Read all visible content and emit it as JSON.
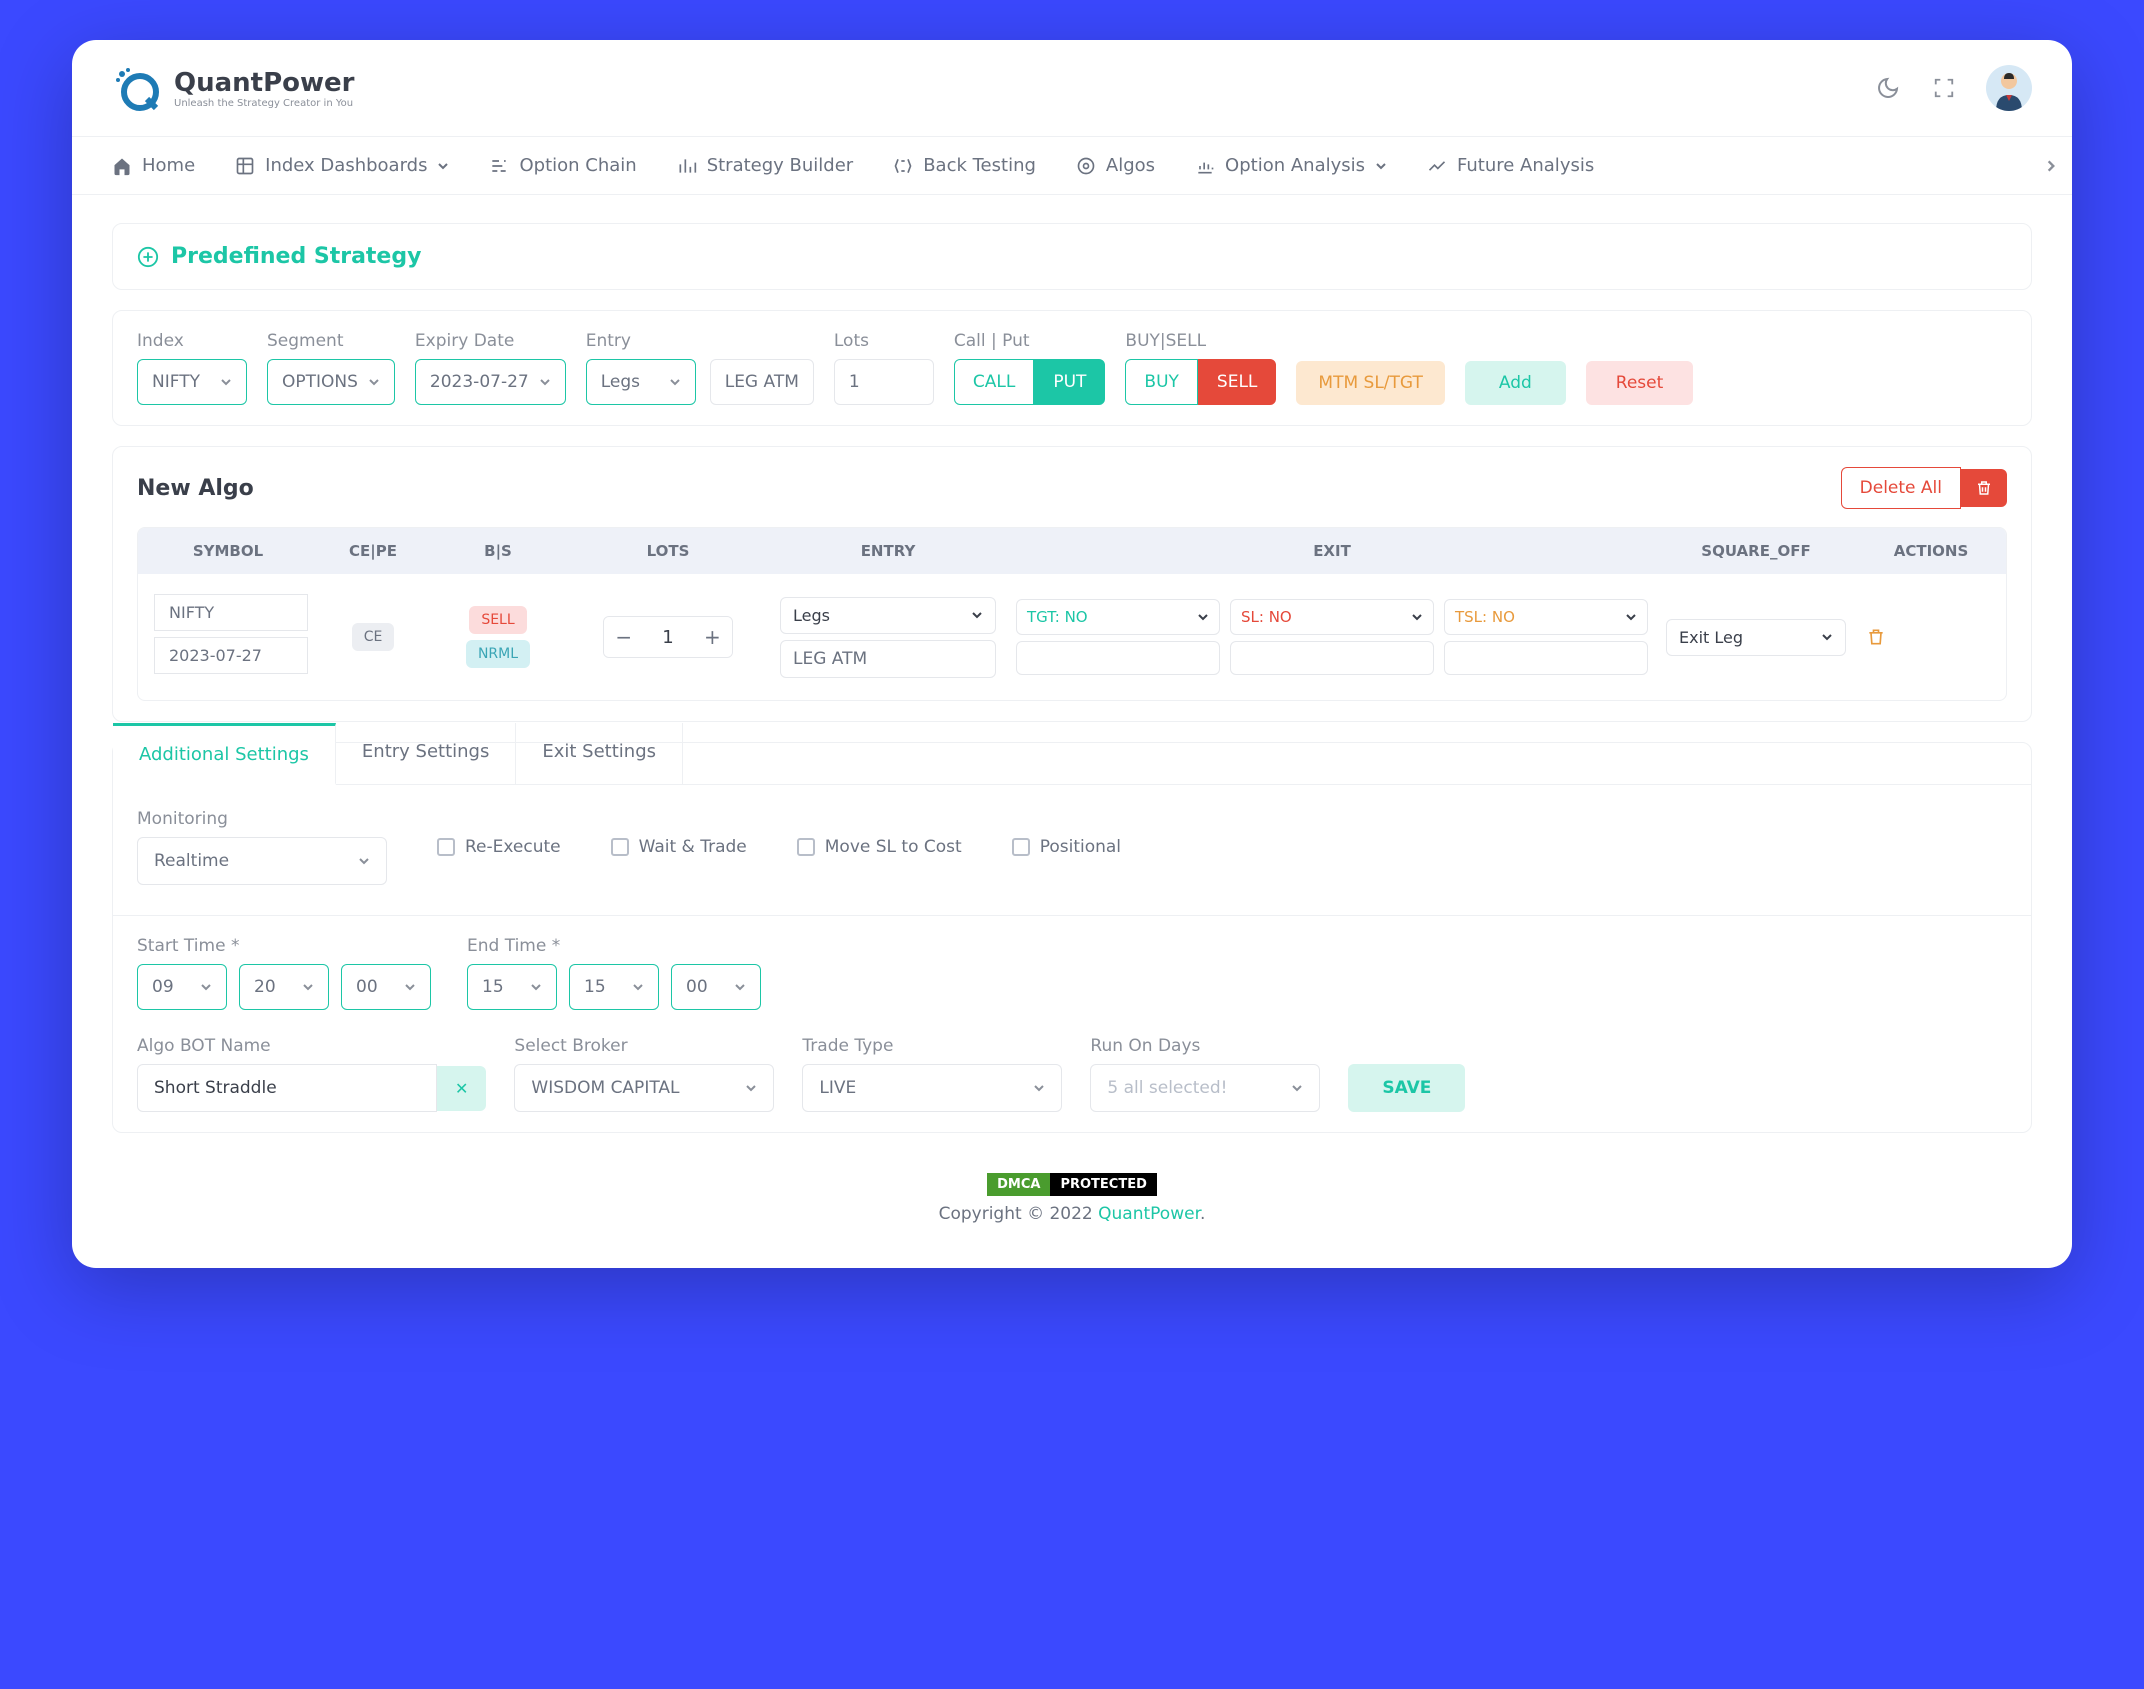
{
  "brand": {
    "name": "QuantPower",
    "tagline": "Unleash the Strategy Creator in You"
  },
  "nav": {
    "items": [
      "Home",
      "Index Dashboards",
      "Option Chain",
      "Strategy Builder",
      "Back Testing",
      "Algos",
      "Option Analysis",
      "Future Analysis"
    ]
  },
  "predefined": {
    "label": "Predefined Strategy"
  },
  "filters": {
    "index_lbl": "Index",
    "index_val": "NIFTY",
    "segment_lbl": "Segment",
    "segment_val": "OPTIONS",
    "expiry_lbl": "Expiry Date",
    "expiry_val": "2023-07-27",
    "entry_lbl": "Entry",
    "entry_val": "Legs",
    "entry_atm": "LEG ATM",
    "lots_lbl": "Lots",
    "lots_val": "1",
    "callput_lbl": "Call | Put",
    "call": "CALL",
    "put": "PUT",
    "buysell_lbl": "BUY|SELL",
    "buy": "BUY",
    "sell": "SELL",
    "mtm": "MTM SL/TGT",
    "add": "Add",
    "reset": "Reset"
  },
  "algo": {
    "title": "New Algo",
    "delete_all": "Delete All",
    "cols": {
      "symbol": "SYMBOL",
      "cepe": "CE|PE",
      "bs": "B|S",
      "lots": "LOTS",
      "entry": "ENTRY",
      "exit": "EXIT",
      "sqoff": "SQUARE_OFF",
      "actions": "ACTIONS"
    },
    "row": {
      "symbol": "NIFTY",
      "date": "2023-07-27",
      "cepe": "CE",
      "sell": "SELL",
      "nrml": "NRML",
      "lots": "1",
      "entry_type": "Legs",
      "entry_atm": "LEG ATM",
      "tgt": "TGT: NO",
      "sl": "SL: NO",
      "tsl": "TSL: NO",
      "sqoff": "Exit Leg"
    }
  },
  "tabs": {
    "additional": "Additional Settings",
    "entry": "Entry Settings",
    "exit": "Exit Settings"
  },
  "settings": {
    "monitoring_lbl": "Monitoring",
    "monitoring_val": "Realtime",
    "reexec": "Re-Execute",
    "wait": "Wait & Trade",
    "movesl": "Move SL to Cost",
    "positional": "Positional",
    "start_lbl": "Start Time *",
    "start_h": "09",
    "start_m": "20",
    "start_s": "00",
    "end_lbl": "End Time *",
    "end_h": "15",
    "end_m": "15",
    "end_s": "00",
    "bot_lbl": "Algo BOT Name",
    "bot_val": "Short Straddle",
    "broker_lbl": "Select Broker",
    "broker_val": "WISDOM CAPITAL",
    "trade_lbl": "Trade Type",
    "trade_val": "LIVE",
    "days_lbl": "Run On Days",
    "days_val": "5 all selected!",
    "save": "SAVE"
  },
  "footer": {
    "dmca1": "DMCA",
    "dmca2": "PROTECTED",
    "copy": "Copyright © 2022 ",
    "brand": "QuantPower",
    "dot": "."
  }
}
